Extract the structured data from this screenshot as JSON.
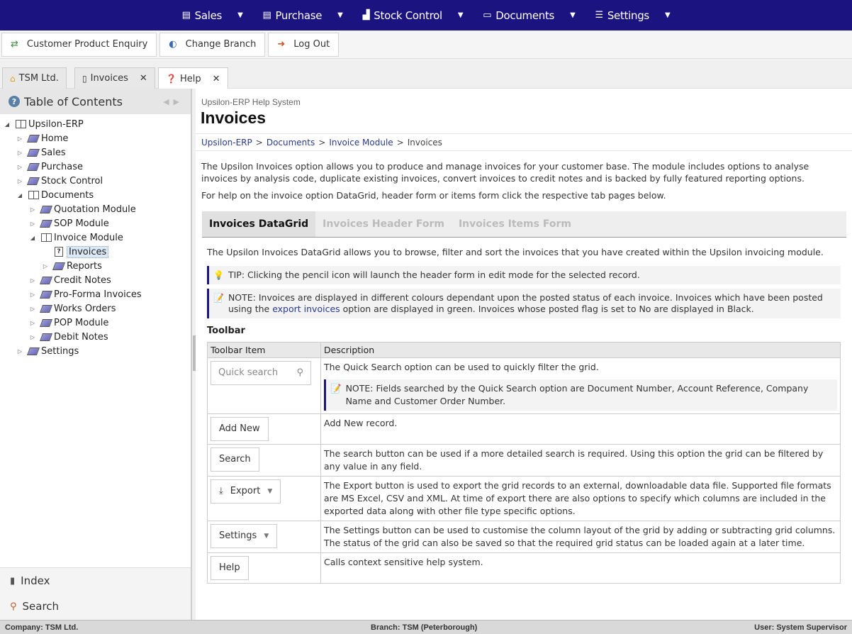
{
  "menubar": {
    "items": [
      {
        "label": "Sales",
        "icon": "sales-icon"
      },
      {
        "label": "Purchase",
        "icon": "purchase-icon"
      },
      {
        "label": "Stock Control",
        "icon": "stock-icon"
      },
      {
        "label": "Documents",
        "icon": "folder-icon"
      },
      {
        "label": "Settings",
        "icon": "settings-icon"
      }
    ],
    "background": "#1b1480"
  },
  "toolbar": {
    "customer_enquiry": "Customer Product Enquiry",
    "change_branch": "Change Branch",
    "log_out": "Log Out"
  },
  "tabs": [
    {
      "label": "TSM Ltd.",
      "icon": "home-icon"
    },
    {
      "label": "Invoices",
      "icon": "document-icon"
    },
    {
      "label": "Help",
      "icon": "help-icon"
    }
  ],
  "toc": {
    "title": "Table of Contents",
    "items": [
      {
        "label": "Upsilon-ERP"
      },
      {
        "label": "Home"
      },
      {
        "label": "Sales"
      },
      {
        "label": "Purchase"
      },
      {
        "label": "Stock Control"
      },
      {
        "label": "Documents"
      },
      {
        "label": "Quotation Module"
      },
      {
        "label": "SOP Module"
      },
      {
        "label": "Invoice Module"
      },
      {
        "label": "Invoices"
      },
      {
        "label": "Reports"
      },
      {
        "label": "Credit Notes"
      },
      {
        "label": "Pro-Forma Invoices"
      },
      {
        "label": "Works Orders"
      },
      {
        "label": "POP Module"
      },
      {
        "label": "Debit Notes"
      },
      {
        "label": "Settings"
      }
    ],
    "index_label": "Index",
    "search_label": "Search"
  },
  "main": {
    "system_label": "Upsilon-ERP Help System",
    "title": "Invoices",
    "breadcrumb": [
      "Upsilon-ERP",
      "Documents",
      "Invoice Module",
      "Invoices"
    ],
    "intro_p1": "The Upsilon Invoices option allows you to produce and manage invoices for your customer base.  The module includes options to analyse invoices by analysis code, duplicate existing invoices, convert invoices to credit notes and is backed by fully featured reporting options.",
    "intro_p2": "For help on the invoice option DataGrid, header form or items form click the respective tab pages below.",
    "inner_tabs": [
      "Invoices DataGrid",
      "Invoices Header Form",
      "Invoices Items Form"
    ],
    "lead": "The Upsilon Invoices DataGrid allows you to browse, filter and sort the invoices that you have created within the Upsilon invoicing module.",
    "tip": "TIP: Clicking the pencil icon will launch the header form in edit mode for the selected record.",
    "note_part1": "NOTE: Invoices are displayed in different colours dependant upon the posted status of each invoice.  Invoices which have been posted using the ",
    "note_link": "export invoices",
    "note_part2": " option are displayed in green.  Invoices whose posted flag is set to No are displayed in Black.",
    "toolbar_heading": "Toolbar",
    "table": {
      "col1": "Toolbar Item",
      "col2": "Description",
      "rows": [
        {
          "item": "Quick search",
          "desc": "The Quick Search option can be used to quickly filter the grid.",
          "note": "NOTE: Fields searched by the Quick Search option are Document Number, Account Reference, Company Name and Customer Order Number."
        },
        {
          "item": "Add New",
          "desc": "Add New record."
        },
        {
          "item": "Search",
          "desc": "The search button can be used if a more detailed search is required.  Using this option the grid can be filtered by any value in any field."
        },
        {
          "item": "Export",
          "desc": "The Export button is used to export the grid records to an external, downloadable data file.  Supported file formats are MS Excel, CSV and XML.  At time of export there are also options to specify which columns are included in the exported data along with other file type specific options."
        },
        {
          "item": "Settings",
          "desc": "The Settings button can be used to customise the column layout of the grid by adding or subtracting grid columns.  The status of the grid can also be saved so that the required grid status can be loaded again at a later time."
        },
        {
          "item": "Help",
          "desc": "Calls context sensitive help system."
        }
      ]
    }
  },
  "statusbar": {
    "company": "Company: TSM Ltd.",
    "branch": "Branch: TSM (Peterborough)",
    "user": "User: System Supervisor"
  }
}
